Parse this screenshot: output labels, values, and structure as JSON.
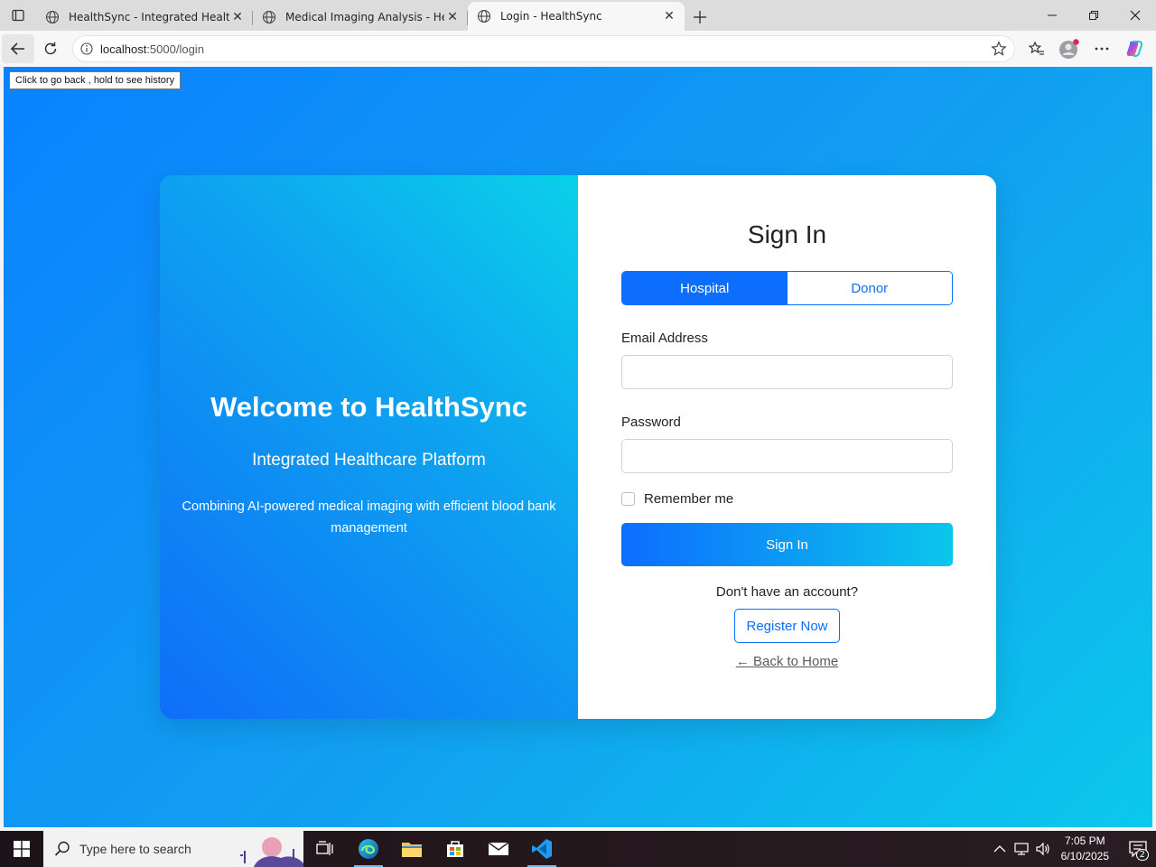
{
  "browser": {
    "tabs": [
      {
        "title": "HealthSync - Integrated Healthcare",
        "active": false
      },
      {
        "title": "Medical Imaging Analysis - HealthSync",
        "active": false
      },
      {
        "title": "Login - HealthSync",
        "active": true
      }
    ],
    "url_host": "localhost",
    "url_path": ":5000/login",
    "tooltip": "Click to go back , hold to see history"
  },
  "page": {
    "welcome_title": "Welcome to HealthSync",
    "tagline": "Integrated Healthcare Platform",
    "description": "Combining AI-powered medical imaging with efficient blood bank management",
    "signin_title": "Sign In",
    "role_toggle": {
      "hospital": "Hospital",
      "donor": "Donor",
      "selected": "Hospital"
    },
    "email_label": "Email Address",
    "email_value": "",
    "password_label": "Password",
    "password_value": "",
    "remember_label": "Remember me",
    "signin_button": "Sign In",
    "no_account_text": "Don't have an account?",
    "register_button": "Register Now",
    "back_home_link": "← Back to Home"
  },
  "taskbar": {
    "search_placeholder": "Type here to search",
    "time": "7:05 PM",
    "date": "6/10/2025",
    "notification_count": "2"
  },
  "colors": {
    "primary": "#0d6efd",
    "accent": "#0bc8ec"
  }
}
